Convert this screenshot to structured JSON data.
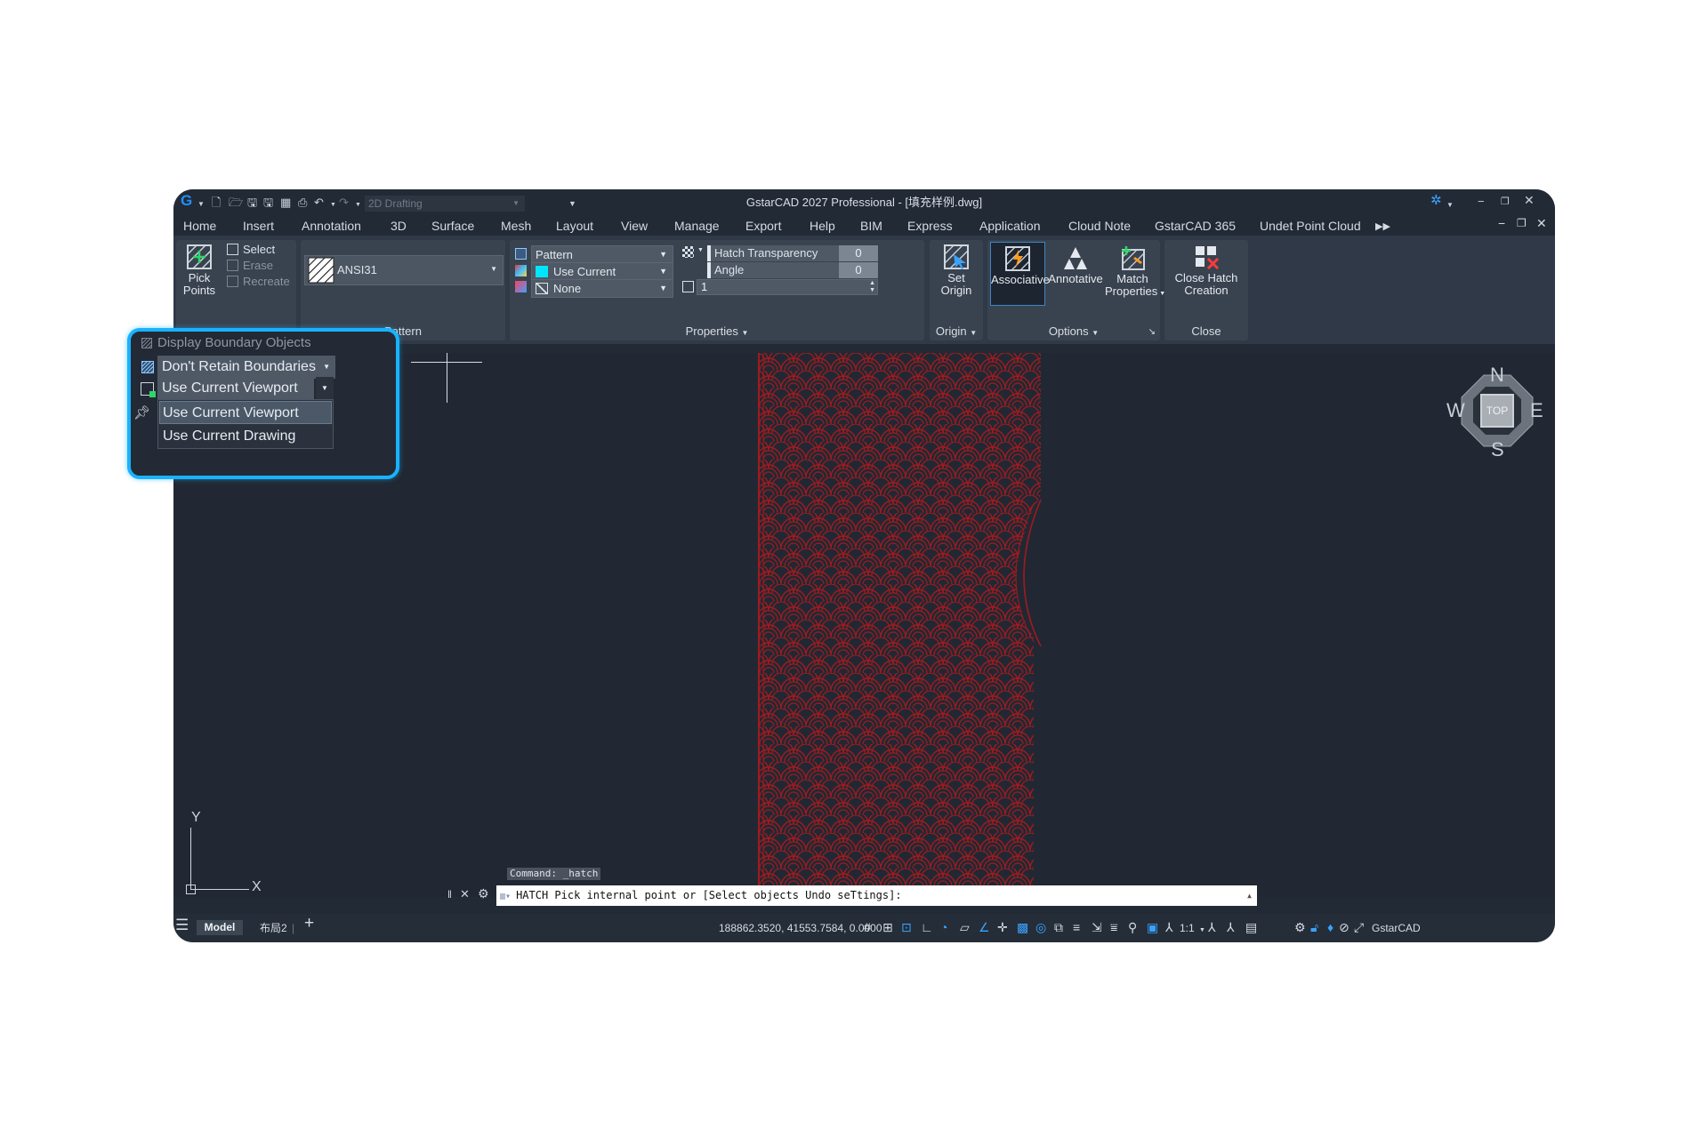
{
  "titlebar": {
    "title": "GstarCAD 2027 Professional - [填充样例.dwg]",
    "workspace": "2D Drafting"
  },
  "menu": [
    "Home",
    "Insert",
    "Annotation",
    "3D",
    "Surface",
    "Mesh",
    "Layout",
    "View",
    "Manage",
    "Export",
    "Help",
    "BIM",
    "Express",
    "Application",
    "Cloud Note",
    "GstarCAD 365",
    "Undet Point Cloud"
  ],
  "ribbon": {
    "boundaries": {
      "pick_points": "Pick\nPoints",
      "select": "Select",
      "erase": "Erase",
      "recreate": "Recreate"
    },
    "pattern": {
      "name": "ANSI31",
      "title": "Pattern"
    },
    "properties": {
      "type": "Pattern",
      "color": "Use Current",
      "bg_color": "None",
      "transparency_label": "Hatch Transparency",
      "transparency_value": "0",
      "angle_label": "Angle",
      "angle_value": "0",
      "scale_value": "1",
      "title": "Properties"
    },
    "origin": {
      "set_origin": "Set\nOrigin",
      "title": "Origin"
    },
    "options": {
      "associative": "Associative",
      "annotative": "Annotative",
      "match": "Match\nProperties",
      "title": "Options"
    },
    "close": {
      "label": "Close Hatch\nCreation",
      "title": "Close"
    }
  },
  "popup": {
    "header": "Display Boundary Objects",
    "retain": "Don't Retain Boundaries",
    "viewport": "Use Current Viewport",
    "options": [
      "Use Current Viewport",
      "Use Current Drawing"
    ]
  },
  "viewcube": {
    "n": "N",
    "s": "S",
    "e": "E",
    "w": "W",
    "face": "TOP"
  },
  "ucs": {
    "x": "X",
    "y": "Y"
  },
  "command": {
    "history": "Command: _hatch",
    "prompt": "HATCH Pick internal point or [Select objects Undo seTtings]:"
  },
  "status": {
    "tab_model": "Model",
    "tab_layout": "布局2",
    "coords": "188862.3520, 41553.7584, 0.0000",
    "scale": "1:1",
    "app": "GstarCAD"
  },
  "colors": {
    "accent": "#19b2ff",
    "hatch": "#a01a1e",
    "cyan_swatch": "#00e5ff"
  }
}
